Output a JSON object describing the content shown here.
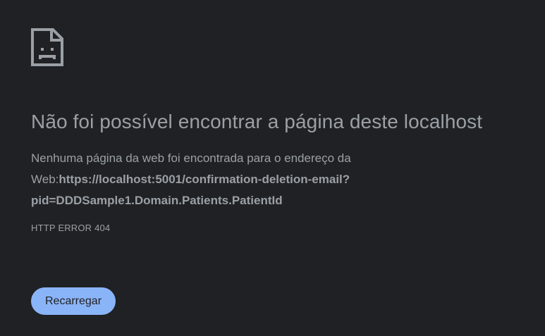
{
  "error_page": {
    "icon": "sad-document-icon",
    "title": "Não foi possível encontrar a página deste localhost",
    "message_prefix": "Nenhuma página da web foi encontrada para o endereço da Web:",
    "url": "https://localhost:5001/confirmation-deletion-email?pid=DDDSample1.Domain.Patients.PatientId",
    "error_code": "HTTP ERROR 404",
    "reload_label": "Recarregar"
  },
  "colors": {
    "background": "#202124",
    "text": "#9aa0a6",
    "button": "#8ab4f8",
    "button_text": "#202124"
  }
}
